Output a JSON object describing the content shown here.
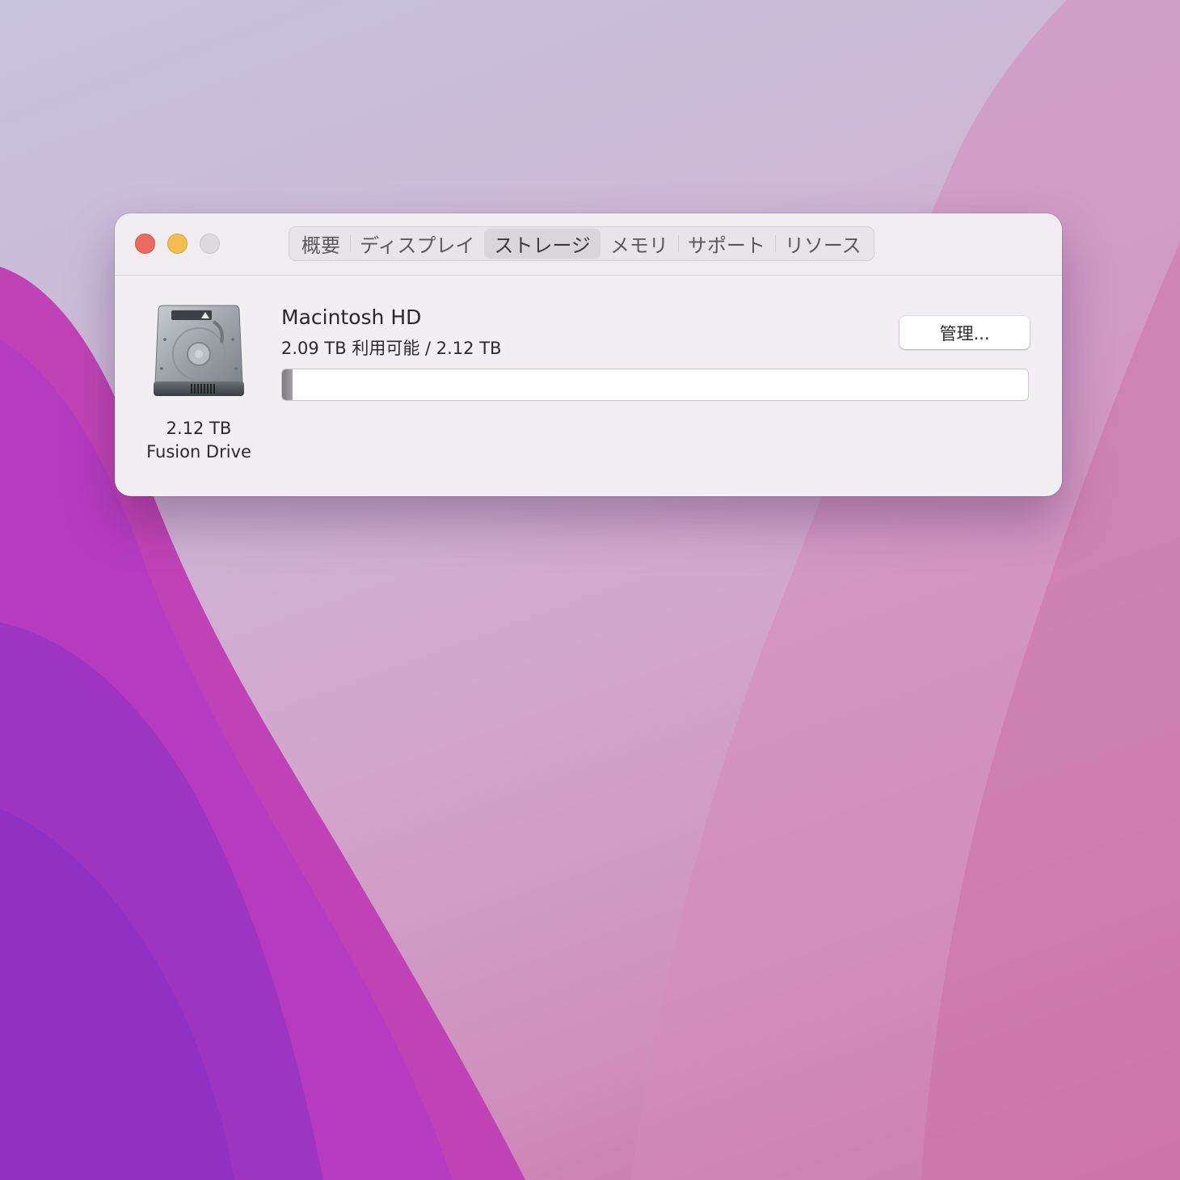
{
  "window": {
    "tabs": [
      {
        "label": "概要",
        "active": false
      },
      {
        "label": "ディスプレイ",
        "active": false
      },
      {
        "label": "ストレージ",
        "active": true
      },
      {
        "label": "メモリ",
        "active": false
      },
      {
        "label": "サポート",
        "active": false
      },
      {
        "label": "リソース",
        "active": false
      }
    ]
  },
  "drive": {
    "icon": "hard-drive-icon",
    "size": "2.12 TB",
    "type": "Fusion Drive"
  },
  "volume": {
    "name": "Macintosh HD",
    "usage": "2.09 TB 利用可能 / 2.12 TB",
    "manage_label": "管理...",
    "used_fraction": 0.014
  },
  "colors": {
    "close": "#ec6a5e",
    "minimize": "#f4be4f",
    "zoom": "#dcdadd"
  }
}
